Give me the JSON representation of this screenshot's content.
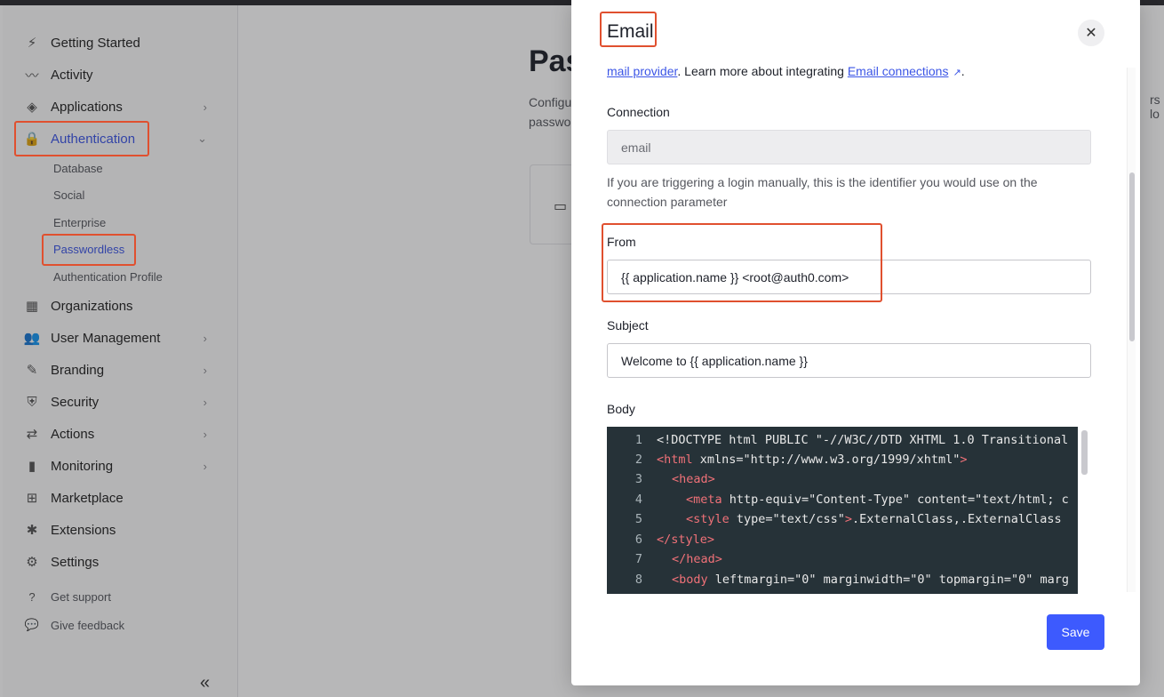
{
  "sidebar": {
    "items": [
      {
        "label": "Getting Started",
        "icon": "bolt-icon"
      },
      {
        "label": "Activity",
        "icon": "activity-icon"
      },
      {
        "label": "Applications",
        "icon": "layers-icon"
      },
      {
        "label": "Authentication",
        "icon": "lock-icon"
      },
      {
        "label": "Organizations",
        "icon": "building-icon"
      },
      {
        "label": "User Management",
        "icon": "users-icon"
      },
      {
        "label": "Branding",
        "icon": "brush-icon"
      },
      {
        "label": "Security",
        "icon": "shield-icon"
      },
      {
        "label": "Actions",
        "icon": "flow-icon"
      },
      {
        "label": "Monitoring",
        "icon": "bar-chart-icon"
      },
      {
        "label": "Marketplace",
        "icon": "grid-plus-icon"
      },
      {
        "label": "Extensions",
        "icon": "puzzle-icon"
      },
      {
        "label": "Settings",
        "icon": "gear-icon"
      }
    ],
    "auth_sub": [
      "Database",
      "Social",
      "Enterprise",
      "Passwordless",
      "Authentication Profile"
    ],
    "footer": [
      {
        "label": "Get support",
        "icon": "help-circle-icon"
      },
      {
        "label": "Give feedback",
        "icon": "feedback-icon"
      }
    ],
    "collapse_glyph": "«"
  },
  "main": {
    "title": "Pas",
    "desc": "Configu",
    "desc2": "passwo",
    "desc_right": "rs lo"
  },
  "modal": {
    "title": "Email",
    "close_glyph": "✕",
    "intro": {
      "link1": "mail provider",
      "text": ". Learn more about integrating ",
      "link2": "Email connections",
      "end": "."
    },
    "connection": {
      "label": "Connection",
      "value": "email",
      "help": "If you are triggering a login manually, this is the identifier you would use on the connection parameter"
    },
    "from": {
      "label": "From",
      "value": "{{ application.name }} <root@auth0.com>"
    },
    "subject": {
      "label": "Subject",
      "value": "Welcome to {{ application.name }}"
    },
    "body": {
      "label": "Body",
      "lines": [
        {
          "n": "1",
          "indent": "",
          "tag": "",
          "rest": "<!DOCTYPE html PUBLIC \"-//W3C//DTD XHTML 1.0 Transitional"
        },
        {
          "n": "2",
          "indent": "",
          "tag": "<html",
          "rest": " xmlns=\"http://www.w3.org/1999/xhtml\"",
          "close": ">"
        },
        {
          "n": "3",
          "indent": "  ",
          "tag": "<head>",
          "rest": ""
        },
        {
          "n": "4",
          "indent": "    ",
          "tag": "<meta",
          "rest": " http-equiv=\"Content-Type\" content=\"text/html; c"
        },
        {
          "n": "5",
          "indent": "    ",
          "tag": "<style",
          "rest": " type=\"text/css\"",
          "close": ">",
          "after": ".ExternalClass,.ExternalClass"
        },
        {
          "n": "6",
          "indent": "",
          "tag": "</style>",
          "rest": ""
        },
        {
          "n": "7",
          "indent": "  ",
          "tag": "</head>",
          "rest": ""
        },
        {
          "n": "8",
          "indent": "  ",
          "tag": "<body",
          "rest": " leftmargin=\"0\" marginwidth=\"0\" topmargin=\"0\" marg"
        }
      ]
    },
    "save_label": "Save"
  },
  "colors": {
    "accent": "#3d5afe",
    "highlight": "#e0502f",
    "code_bg": "#263238",
    "code_tag": "#f07178"
  }
}
